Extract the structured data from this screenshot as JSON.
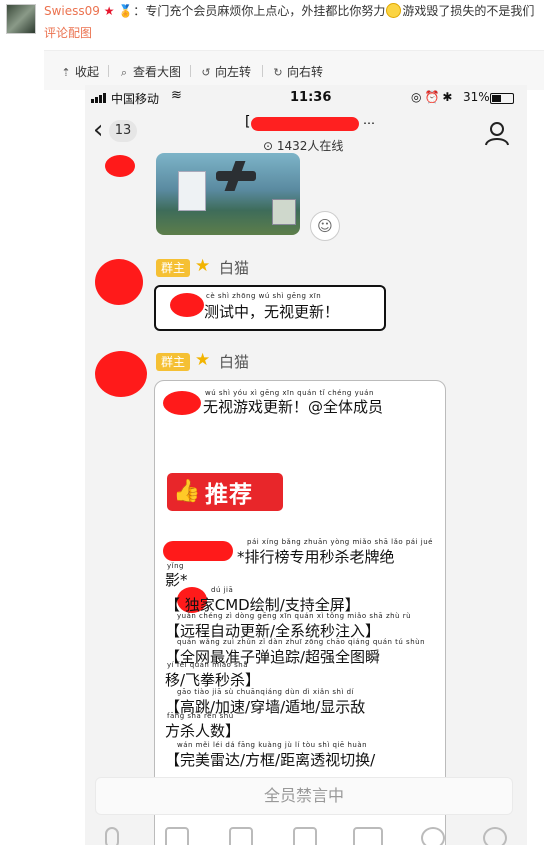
{
  "comment": {
    "username": "Swiess09",
    "separator": "：",
    "text_a": "专门充个会员麻烦你上点心，外挂都比你努力",
    "text_b": "游戏毁了损失的不是我们",
    "media_link": "评论配图"
  },
  "actions": {
    "collapse": "收起",
    "view_large": "查看大图",
    "rotate_left": "向左转",
    "rotate_right": "向右转"
  },
  "phone": {
    "status": {
      "carrier": "中国移动",
      "time": "11:36",
      "battery": "31%"
    },
    "nav": {
      "back_count": "13",
      "title_dots": "…",
      "online": "1432人在线"
    },
    "messages": [
      {
        "badge": "群主",
        "sender": "白猫",
        "text": "测试中，无视更新！"
      },
      {
        "badge": "群主",
        "sender": "白猫"
      }
    ],
    "pinyin": {
      "msg1": "cè shì zhōng   wú shì gēng xīn",
      "l1": "wú  shì  yóu  xì  gēng  xīn           quán  tǐ  chéng yuán",
      "l2": "pái  xíng bǎng zhuān yòng  miǎo  shā  lǎo  pái  jué",
      "l2b": "yǐng",
      "l3": "dú   jiā",
      "l4": "yuǎn chéng  zì  dòng gēng  xīn     quán  xì  tǒng miǎo  shā  zhù  rù",
      "l5": "quán wǎng  zuì  zhǔn  zǐ   dàn zhuī zōng  chāo qiáng quán  tú  shùn",
      "l5b": "yí   fēi quán miǎo  shā",
      "l6": "gāo  tiào   jiā  sù  chuānqiáng  dùn   dì    xiǎn  shì   dí",
      "l6b": "fāng shā  rén  shù",
      "l7": "wán  měi  léi   dá   fāng kuàng   jù   lí   tòu  shì  qiē  huàn"
    },
    "big_bubble": {
      "line1": "无视游戏更新！@全体成员",
      "recommend": "推荐",
      "line2": "*排行榜专用秒杀老牌绝",
      "line2b": "影*",
      "line3": "【 独家CMD绘制/支持全屏】",
      "line4": "【远程自动更新/全系统秒注入】",
      "line5": "【全网最准子弹追踪/超强全图瞬",
      "line5b": "移/飞拳秒杀】",
      "line6": "【高跳/加速/穿墙/遁地/显示敌",
      "line6b": "方杀人数】",
      "line7": "【完美雷达/方框/距离透视切换/"
    },
    "mute_text": "全员禁言中"
  }
}
